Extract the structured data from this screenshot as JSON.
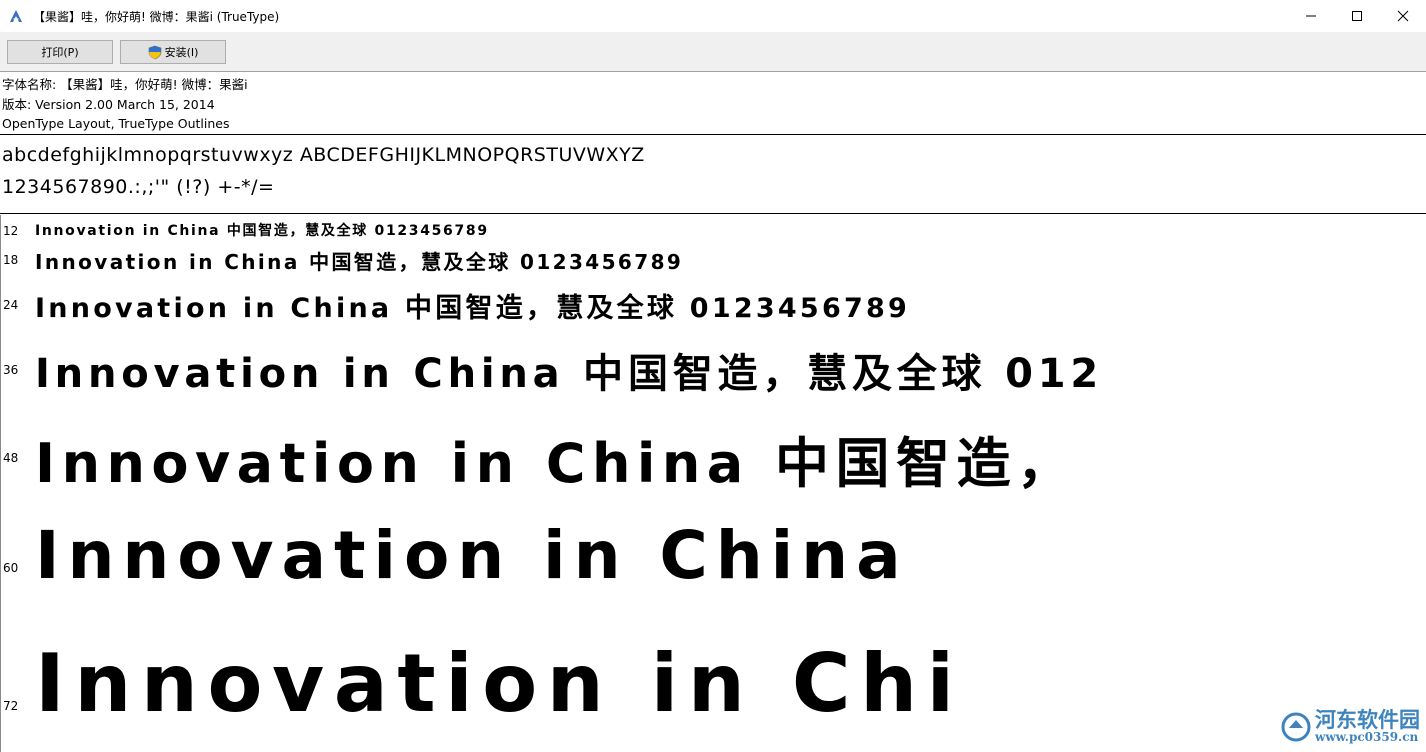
{
  "window": {
    "title": "【果酱】哇，你好萌!    微博：果酱i (TrueType)",
    "icon": "font-viewer-app-icon",
    "controls": [
      "minimize-icon",
      "maximize-icon",
      "close-icon"
    ]
  },
  "toolbar": {
    "print_label": "打印(P)",
    "install_label": "安装(I)",
    "install_icon": "uac-shield-icon"
  },
  "info": {
    "font_name": "字体名称: 【果酱】哇，你好萌!    微博：果酱i",
    "version": "版本: Version 2.00 March 15, 2014",
    "type": "OpenType Layout, TrueType Outlines"
  },
  "charset": {
    "line1": "abcdefghijklmnopqrstuvwxyz ABCDEFGHIJKLMNOPQRSTUVWXYZ",
    "line2": "1234567890.:,;'\" (!?) +-*/="
  },
  "samples": [
    {
      "size": "12",
      "text": "Innovation in China 中国智造，慧及全球 0123456789"
    },
    {
      "size": "18",
      "text": "Innovation in China 中国智造，慧及全球 0123456789"
    },
    {
      "size": "24",
      "text": "Innovation in China 中国智造，慧及全球 0123456789"
    },
    {
      "size": "36",
      "text": "Innovation in China 中国智造，慧及全球 012"
    },
    {
      "size": "48",
      "text": "Innovation in China 中国智造，"
    },
    {
      "size": "60",
      "text": "Innovation in China"
    },
    {
      "size": "72",
      "text": "Innovation in Chi"
    }
  ],
  "watermark": {
    "title": "河东软件园",
    "url": "www.pc0359.cn"
  }
}
